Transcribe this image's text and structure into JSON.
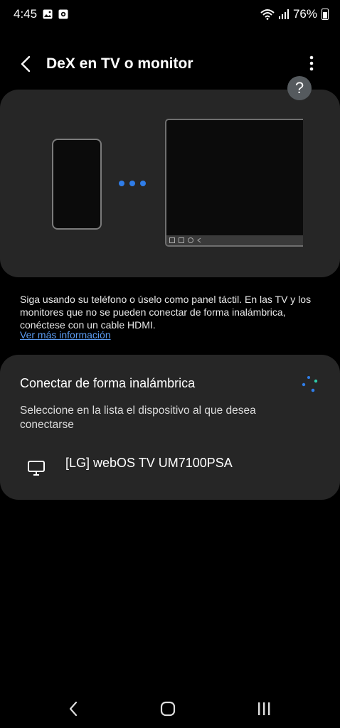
{
  "status_bar": {
    "time": "4:45",
    "battery": "76%",
    "icons": [
      "gallery-icon",
      "record-icon",
      "wifi-icon",
      "signal-icon",
      "battery-icon"
    ]
  },
  "app_bar": {
    "title": "DeX en TV o monitor",
    "back_icon": "chevron-left-icon",
    "more_icon": "more-vertical-icon"
  },
  "help": {
    "label": "?"
  },
  "hero": {
    "accent_color": "#2f7de8"
  },
  "description": {
    "text": "Siga usando su teléfono o úselo como panel táctil. En las TV y los monitores que no se pueden conectar de forma inalámbrica, conéctese con un cable HDMI.",
    "link": "Ver más información"
  },
  "wireless": {
    "title": "Conectar de forma inalámbrica",
    "subtitle": "Seleccione en la lista el dispositivo al que desea conectarse",
    "devices": [
      {
        "name": "[LG] webOS TV UM7100PSA",
        "icon": "monitor-icon"
      }
    ]
  },
  "navigation": {
    "back_icon": "nav-back-icon",
    "home_icon": "nav-home-icon",
    "recent_icon": "nav-recent-apps-icon"
  },
  "colors": {
    "background": "#000000",
    "card": "#262626",
    "link": "#5b9bf0",
    "accent": "#2f7de8"
  }
}
